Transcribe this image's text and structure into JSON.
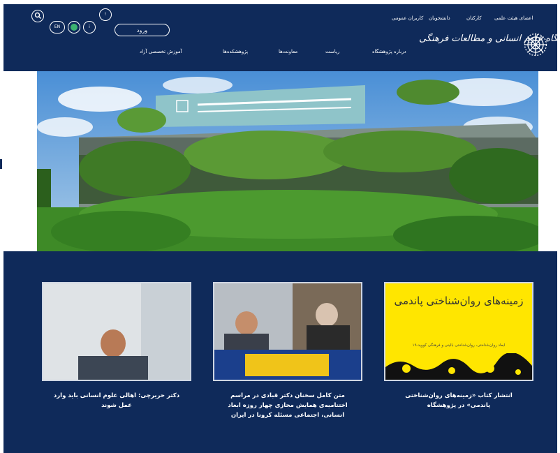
{
  "header": {
    "top_links": [
      "اعضای هیئت علمی",
      "کارکنان",
      "دانشجویان",
      "کاربران عمومی"
    ],
    "logo_text": "پژوهشگاه علوم انسانی و مطالعات فرهنگی",
    "nav": [
      "درباره پژوهشگاه",
      "ریاست",
      "معاونت‌ها",
      "پژوهشکده‌ها",
      "آموزش تخصصی آزاد"
    ],
    "login_label": "ورود",
    "icons": [
      "search-icon",
      "language-en-icon",
      "home-icon",
      "info-icon",
      "notification-icon"
    ],
    "en_label": "EN",
    "info_label": "i",
    "bell_label": "!",
    "colors": {
      "primary": "#0f2a5a",
      "accent": "#ffe600"
    }
  },
  "hero": {
    "image": "institute-building-photo"
  },
  "news": [
    {
      "title": "انتشار کتاب «زمینه‌های روان‌شناختی پاندمی» در پژوهشگاه",
      "poster_title": "زمینه‌های روان‌شناختی پاندمی",
      "poster_sub": "ابعاد روان‌شناختی، روان‌شناختی بالینی و فرهنگی کووید-۱۹"
    },
    {
      "title": "متن کامل سخنان دکتر قبادی در مراسم اختتامیه‌ی همایش مجازی چهار روزه ابعاد انسانی، اجتماعی مسئله کرونا در ایران"
    },
    {
      "title": "دکتر حریرچی: اهالی علوم انسانی باید وارد عمل شوند"
    }
  ]
}
